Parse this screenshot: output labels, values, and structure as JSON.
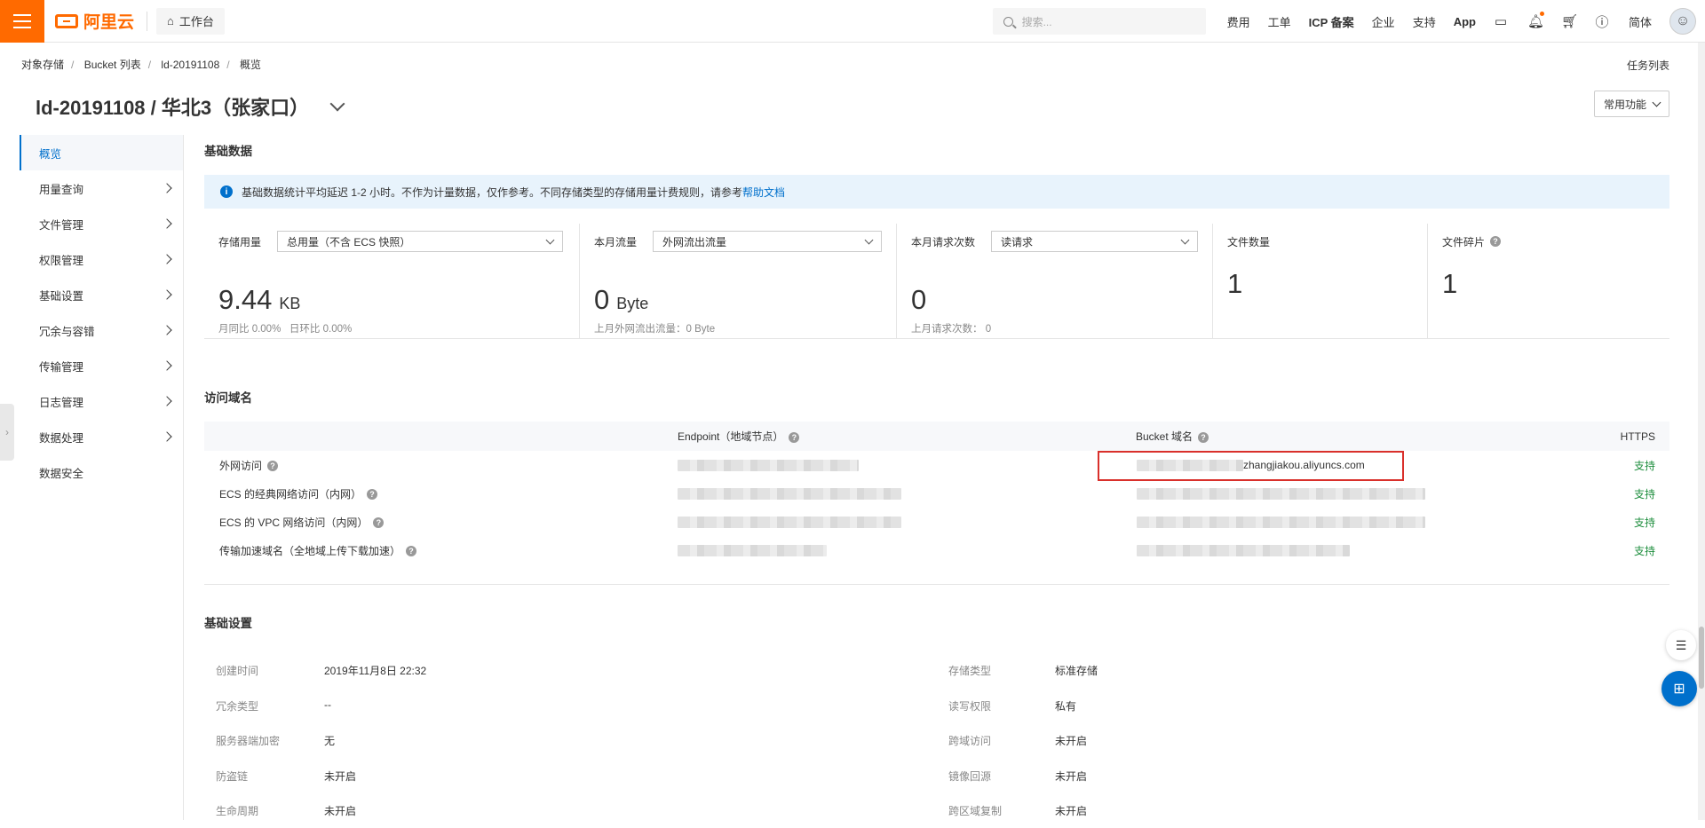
{
  "topbar": {
    "logo": "阿里云",
    "workbench": "工作台",
    "search_placeholder": "搜索...",
    "links": [
      "费用",
      "工单",
      "ICP 备案",
      "企业",
      "支持",
      "App"
    ],
    "lang": "简体"
  },
  "breadcrumb": [
    "对象存储",
    "Bucket 列表",
    "ld-20191108",
    "概览"
  ],
  "task_list": "任务列表",
  "page_title": "ld-20191108 / 华北3（张家口）",
  "common_functions": "常用功能",
  "sidebar": {
    "items": [
      {
        "label": "概览",
        "active": true,
        "arrow": false
      },
      {
        "label": "用量查询",
        "arrow": true
      },
      {
        "label": "文件管理",
        "arrow": true
      },
      {
        "label": "权限管理",
        "arrow": true
      },
      {
        "label": "基础设置",
        "arrow": true
      },
      {
        "label": "冗余与容错",
        "arrow": true
      },
      {
        "label": "传输管理",
        "arrow": true
      },
      {
        "label": "日志管理",
        "arrow": true
      },
      {
        "label": "数据处理",
        "arrow": true
      },
      {
        "label": "数据安全",
        "arrow": false
      }
    ]
  },
  "basic_data": {
    "title": "基础数据",
    "notice": "基础数据统计平均延迟 1-2 小时。不作为计量数据，仅作参考。不同存储类型的存储用量计费规则，请参考",
    "notice_link": "帮助文档",
    "stats": {
      "storage": {
        "label": "存储用量",
        "select": "总用量（不含 ECS 快照）",
        "value": "9.44",
        "unit": "KB",
        "sub_left": "月同比  0.00%",
        "sub_right": "日环比  0.00%"
      },
      "traffic": {
        "label": "本月流量",
        "select": "外网流出流量",
        "value": "0",
        "unit": "Byte",
        "sub": "上月外网流出流量：0 Byte"
      },
      "requests": {
        "label": "本月请求次数",
        "select": "读请求",
        "value": "0",
        "sub": "上月请求次数：  0"
      },
      "files": {
        "label": "文件数量",
        "value": "1"
      },
      "fragments": {
        "label": "文件碎片",
        "value": "1"
      }
    }
  },
  "domains": {
    "title": "访问域名",
    "headers": {
      "endpoint": "Endpoint（地域节点）",
      "bucket": "Bucket 域名",
      "https": "HTTPS"
    },
    "rows": [
      {
        "name": "外网访问",
        "bucket_visible": "zhangjiakou.aliyuncs.com",
        "https": "支持"
      },
      {
        "name": "ECS 的经典网络访问（内网）",
        "https": "支持"
      },
      {
        "name": "ECS 的 VPC 网络访问（内网）",
        "https": "支持"
      },
      {
        "name": "传输加速域名（全地域上传下载加速）",
        "https": "支持"
      }
    ]
  },
  "settings": {
    "title": "基础设置",
    "rows": [
      {
        "k1": "创建时间",
        "v1": "2019年11月8日 22:32",
        "k2": "存储类型",
        "v2": "标准存储"
      },
      {
        "k1": "冗余类型",
        "v1": "--",
        "k2": "读写权限",
        "v2": "私有"
      },
      {
        "k1": "服务器端加密",
        "v1": "无",
        "k2": "跨域访问",
        "v2": "未开启"
      },
      {
        "k1": "防盗链",
        "v1": "未开启",
        "k2": "镜像回源",
        "v2": "未开启"
      },
      {
        "k1": "生命周期",
        "v1": "未开启",
        "k2": "跨区域复制",
        "v2": "未开启"
      }
    ]
  },
  "colors": {
    "brand": "#ff6a00",
    "link": "#0070cc",
    "success": "#1e8e3e",
    "highlight": "#d9302b"
  }
}
